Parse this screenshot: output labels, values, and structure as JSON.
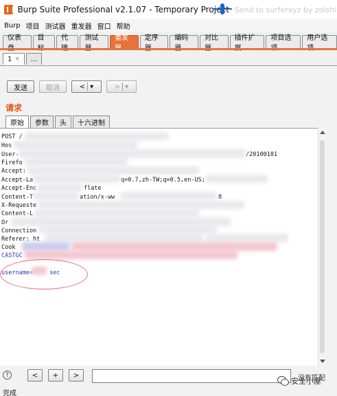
{
  "window": {
    "title": "Burp Suite Professional v2.1.07 - Temporary Project",
    "title_ghost": "Send to surferxyz by zolshie"
  },
  "menu": [
    "Burp",
    "项目",
    "测试器",
    "重发器",
    "窗口",
    "帮助"
  ],
  "main_tabs": [
    {
      "label": "仪表盘",
      "active": false
    },
    {
      "label": "目标",
      "active": false
    },
    {
      "label": "代理",
      "active": false
    },
    {
      "label": "测试器",
      "active": false
    },
    {
      "label": "重发器",
      "active": true
    },
    {
      "label": "定序器",
      "active": false
    },
    {
      "label": "编码器",
      "active": false
    },
    {
      "label": "对比器",
      "active": false
    },
    {
      "label": "插件扩展",
      "active": false
    },
    {
      "label": "项目选项",
      "active": false
    },
    {
      "label": "用户选项",
      "active": false
    }
  ],
  "sub_tabs": {
    "first": "1",
    "close": "×",
    "more": "..."
  },
  "toolbar": {
    "send": "发送",
    "cancel": "取消",
    "back": "<",
    "forward": ">",
    "dropdown": "▾"
  },
  "request": {
    "title": "请求",
    "tabs": [
      "原始",
      "参数",
      "头",
      "十六进制"
    ],
    "lines": [
      "POST /",
      "Hos",
      "User-",
      "Firefo",
      "Accept: ",
      "Accept-La",
      "Accept-Enc",
      "Content-T",
      "X-Requeste",
      "Content-L",
      "Or",
      "Connection",
      "Referer: ht",
      "Cook",
      "CASTGC"
    ],
    "fragments": {
      "useragent_tail": "/20100101",
      "language_tail": "q=0.7,zh-TW;q=0.5,en-US;",
      "encoding_tail": "flate",
      "content_type_tail": "ation/x-ww",
      "content_type_end": "8"
    },
    "body_start": "username=",
    "body_end": "sec"
  },
  "search": {
    "prev": "<",
    "add": "+",
    "next": ">",
    "value": "",
    "matches": "没有匹配"
  },
  "help": "?",
  "status": "完成",
  "watermark": "安全小屋"
}
